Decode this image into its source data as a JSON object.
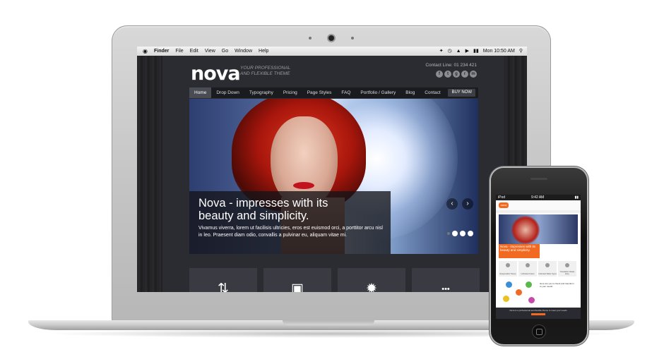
{
  "menubar": {
    "apple": "",
    "items": [
      "Finder",
      "File",
      "Edit",
      "View",
      "Go",
      "Window",
      "Help"
    ],
    "status_icons": [
      "bluetooth-icon",
      "time-machine-icon",
      "wifi-icon",
      "volume-icon",
      "battery-icon"
    ],
    "clock": "Mon 10:50 AM",
    "spotlight_icon": "search-icon"
  },
  "site": {
    "logo": "nova",
    "tagline_line1": "YOUR PROFESSIONAL",
    "tagline_line2": "AND FLEXIBLE THEME",
    "contact": "Contact Line: 01 234 421",
    "social": [
      "f",
      "t",
      "g",
      "r",
      "m"
    ],
    "nav": [
      "Home",
      "Drop Down",
      "Typography",
      "Pricing",
      "Page Styles",
      "FAQ",
      "Portfolio / Gallery",
      "Blog",
      "Contact"
    ],
    "buy_now": "BUY NOW",
    "slide": {
      "heading": "Nova - impresses with its beauty and simplicity.",
      "body": "Vivamus viverra, lorem ut facilisis ultricies, eros est euismod orci, a porttitor arcu nisl in leo. Praesent diam odio, convallis a pulvinar eu, aliquam vitae mi.",
      "prev": "‹",
      "next": "›",
      "active_slide": 1,
      "slide_count": 3
    },
    "features": [
      "⇅",
      "▣",
      "✹",
      "•••"
    ]
  },
  "phone": {
    "carrier": "iPod",
    "time": "9:42 AM",
    "logo": "nova",
    "caption": "Nova - impresses with its beauty and simplicity.",
    "boxes": [
      "Responsible Theme",
      "Unlimited Colors",
      "Unlimited Slider Types",
      "Translation Ready Easy"
    ],
    "text": "Here are you to check and transform to your needs",
    "footer": "Nova is a professional and flexible theme to meet your needs"
  },
  "colors": {
    "accent": "#f26a21",
    "nav_bg": "#1a1b1f",
    "site_bg": "#2b2c32"
  }
}
